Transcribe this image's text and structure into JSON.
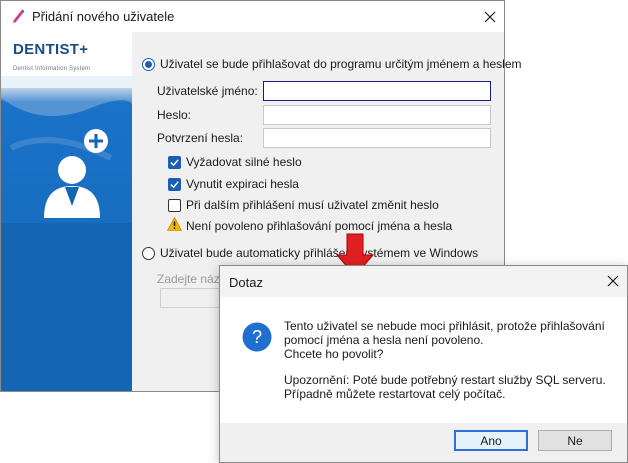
{
  "main_window": {
    "title": "Přidání nového uživatele",
    "logo": "DENTIST+",
    "logo_sub": "Dentist Information System",
    "option_password": "Uživatel se bude přihlašovat do programu určitým jménem a heslem",
    "username_label": "Uživatelské jméno:",
    "username_value": "",
    "password_label": "Heslo:",
    "password_value": "",
    "confirm_label": "Potvrzení hesla:",
    "confirm_value": "",
    "checks": [
      {
        "label": "Vyžadovat silné heslo",
        "checked": true
      },
      {
        "label": "Vynutit expiraci hesla",
        "checked": true
      },
      {
        "label": "Při dalším přihlášení musí uživatel změnit heslo",
        "checked": false
      }
    ],
    "warning": "Není povoleno přihlašování pomocí jména a hesla",
    "option_windows": "Uživatel bude automaticky přihlášen systémem ve Windows",
    "domain_label": "Zadejte náze"
  },
  "dialog": {
    "title": "Dotaz",
    "line1": "Tento uživatel se nebude moci přihlásit, protože přihlašování",
    "line2": "pomocí jména a hesla není povoleno.",
    "line3": "Chcete ho povolit?",
    "line4": "Upozornění: Poté bude potřebný restart služby SQL serveru.",
    "line5": "Případně můžete restartovat celý počítač.",
    "yes": "Ano",
    "no": "Ne"
  },
  "colors": {
    "accent": "#1a5fb4",
    "arrow": "#e02020",
    "brand": "#1b4c86"
  }
}
